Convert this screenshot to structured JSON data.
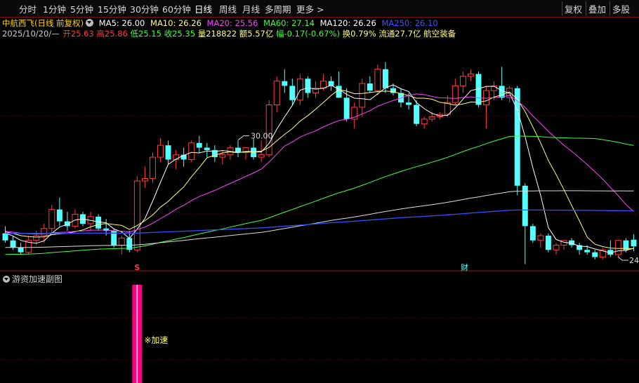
{
  "toolbar": {
    "periods": [
      "分时",
      "1分钟",
      "5分钟",
      "15分钟",
      "30分钟",
      "60分钟",
      "日线",
      "周线",
      "月线",
      "多周期",
      "更多 >"
    ],
    "active": "日线",
    "right": [
      "复权",
      "叠加",
      "多股"
    ]
  },
  "stock": {
    "name": "中航西飞(日线 前复权)",
    "ma5": "MA5: 26.00",
    "ma10": "MA10: 26.26",
    "ma20": "MA20: 25.56",
    "ma60": "MA60: 27.14",
    "ma120": "MA120: 26.26",
    "ma250": "MA250: 26.10",
    "date": "2025/10/20/—",
    "open": "开25.63",
    "high": "高25.86",
    "low": "低25.15",
    "close": "收25.35",
    "volume": "量218822",
    "amount": "额5.57亿",
    "change": "幅-0.17(-0.67%)",
    "turnover": "换0.79%",
    "float": "流通27.7亿",
    "sector": "航空装备"
  },
  "chart_annotations": {
    "high_label": "30.00",
    "low_label": "24",
    "marker_s": "S",
    "marker_cai": "财"
  },
  "sub_panel": {
    "title": "游资加速副图",
    "signal_label": "※加速"
  },
  "colors": {
    "up": "#ff3c3c",
    "down": "#54ffff",
    "ma5": "#ffffff",
    "ma10": "#ffff80",
    "ma20": "#ff40ff",
    "ma60": "#40ff40",
    "ma120": "#ffffff",
    "ma250": "#3050ff",
    "signal": "#ff0080"
  },
  "chart_data": {
    "type": "candlestick",
    "ohlc": [
      [
        25.9,
        26.2,
        25.5,
        25.6
      ],
      [
        25.6,
        25.8,
        25.2,
        25.3
      ],
      [
        25.3,
        25.5,
        25.0,
        25.1
      ],
      [
        25.1,
        25.8,
        25.0,
        25.6
      ],
      [
        25.6,
        26.0,
        25.4,
        25.8
      ],
      [
        25.8,
        26.3,
        25.5,
        26.1
      ],
      [
        26.1,
        27.1,
        25.9,
        26.9
      ],
      [
        26.9,
        27.4,
        26.2,
        26.4
      ],
      [
        26.4,
        26.8,
        26.0,
        26.2
      ],
      [
        26.2,
        26.9,
        26.1,
        26.7
      ],
      [
        26.7,
        26.8,
        26.2,
        26.3
      ],
      [
        26.3,
        26.8,
        26.0,
        26.6
      ],
      [
        26.6,
        26.7,
        26.0,
        26.1
      ],
      [
        26.1,
        26.5,
        25.8,
        26.0
      ],
      [
        26.0,
        26.1,
        25.3,
        25.4
      ],
      [
        25.4,
        25.8,
        25.0,
        25.7
      ],
      [
        25.7,
        26.0,
        25.1,
        25.2
      ],
      [
        25.2,
        28.3,
        25.1,
        28.1
      ],
      [
        28.1,
        28.7,
        27.8,
        28.2
      ],
      [
        28.2,
        29.3,
        28.0,
        29.1
      ],
      [
        29.1,
        29.9,
        28.9,
        29.6
      ],
      [
        29.6,
        29.8,
        28.8,
        29.0
      ],
      [
        29.0,
        29.4,
        28.6,
        29.2
      ],
      [
        29.2,
        29.5,
        28.7,
        29.0
      ],
      [
        29.0,
        29.8,
        28.9,
        29.7
      ],
      [
        29.7,
        30.0,
        29.3,
        29.5
      ],
      [
        29.5,
        29.7,
        29.1,
        29.4
      ],
      [
        29.4,
        29.6,
        28.9,
        29.1
      ],
      [
        29.1,
        29.4,
        28.8,
        29.2
      ],
      [
        29.2,
        29.6,
        29.0,
        29.5
      ],
      [
        29.5,
        29.8,
        29.1,
        29.3
      ],
      [
        29.3,
        29.5,
        29.0,
        29.5
      ],
      [
        29.5,
        29.9,
        29.0,
        29.1
      ],
      [
        29.1,
        29.8,
        28.9,
        29.2
      ],
      [
        29.2,
        31.5,
        29.1,
        31.3
      ],
      [
        31.3,
        32.5,
        31.0,
        32.3
      ],
      [
        32.3,
        32.8,
        31.8,
        32.1
      ],
      [
        32.1,
        32.4,
        31.3,
        31.5
      ],
      [
        31.5,
        32.6,
        31.3,
        32.4
      ],
      [
        32.4,
        32.5,
        31.6,
        31.8
      ],
      [
        31.8,
        32.3,
        31.6,
        32.0
      ],
      [
        32.0,
        32.6,
        31.9,
        32.3
      ],
      [
        32.3,
        32.5,
        31.9,
        32.1
      ],
      [
        32.1,
        32.7,
        31.6,
        31.6
      ],
      [
        31.6,
        32.0,
        30.6,
        30.7
      ],
      [
        30.7,
        31.4,
        30.3,
        31.2
      ],
      [
        31.2,
        32.4,
        30.8,
        32.2
      ],
      [
        32.2,
        32.5,
        31.8,
        31.9
      ],
      [
        31.9,
        33.0,
        31.7,
        32.8
      ],
      [
        32.8,
        33.1,
        31.8,
        32.0
      ],
      [
        32.0,
        32.2,
        31.7,
        31.8
      ],
      [
        31.8,
        32.0,
        31.2,
        31.4
      ],
      [
        31.4,
        31.8,
        31.1,
        31.3
      ],
      [
        31.3,
        31.5,
        30.4,
        30.5
      ],
      [
        30.5,
        30.8,
        30.3,
        30.7
      ],
      [
        30.7,
        31.0,
        30.6,
        30.8
      ],
      [
        30.8,
        31.0,
        30.7,
        30.9
      ],
      [
        30.9,
        31.7,
        30.8,
        31.4
      ],
      [
        31.4,
        32.4,
        31.3,
        32.1
      ],
      [
        32.1,
        32.7,
        31.8,
        32.5
      ],
      [
        32.5,
        32.8,
        32.3,
        32.6
      ],
      [
        32.6,
        32.7,
        31.2,
        31.3
      ],
      [
        31.3,
        32.1,
        30.3,
        31.9
      ],
      [
        31.9,
        32.3,
        31.5,
        32.1
      ],
      [
        32.1,
        32.9,
        31.5,
        31.6
      ],
      [
        31.6,
        32.1,
        31.4,
        32.0
      ],
      [
        32.0,
        32.1,
        27.5,
        27.9
      ],
      [
        27.9,
        28.0,
        24.6,
        26.2
      ],
      [
        26.2,
        26.3,
        25.5,
        25.6
      ],
      [
        25.6,
        25.9,
        25.3,
        25.8
      ],
      [
        25.8,
        25.9,
        25.1,
        25.2
      ],
      [
        25.2,
        25.5,
        25.0,
        25.4
      ],
      [
        25.4,
        25.6,
        25.2,
        25.6
      ],
      [
        25.6,
        25.7,
        25.3,
        25.4
      ],
      [
        25.4,
        25.5,
        25.0,
        25.2
      ],
      [
        25.2,
        25.4,
        25.0,
        25.1
      ],
      [
        25.1,
        25.2,
        24.8,
        24.9
      ],
      [
        24.9,
        25.3,
        24.8,
        25.2
      ],
      [
        25.2,
        25.6,
        24.9,
        25.0
      ],
      [
        25.0,
        25.6,
        24.9,
        25.6
      ],
      [
        25.6,
        25.7,
        25.1,
        25.2
      ],
      [
        25.63,
        25.86,
        25.15,
        25.35
      ]
    ],
    "ylim": [
      24.5,
      34.0
    ],
    "high_value": 30.0,
    "low_value": 24,
    "signal_bar_index": 17
  }
}
